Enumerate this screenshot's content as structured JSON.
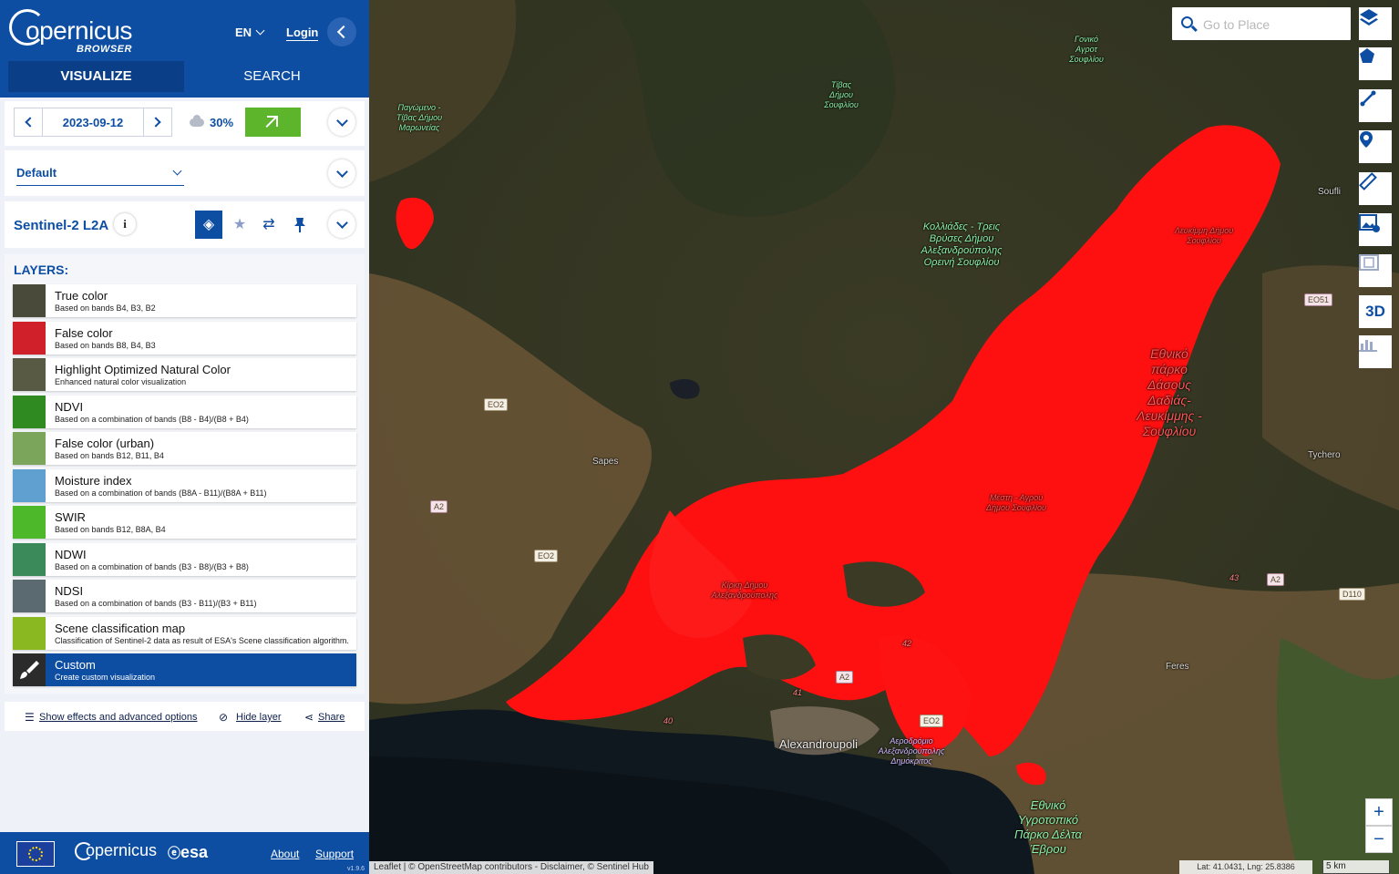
{
  "header": {
    "brand": "opernicus",
    "brand_sub": "BROWSER",
    "language": "EN",
    "login_label": "Login",
    "tabs": [
      {
        "label": "VISUALIZE",
        "active": true
      },
      {
        "label": "SEARCH",
        "active": false
      }
    ]
  },
  "date_panel": {
    "date": "2023-09-12",
    "cloud_coverage": "30%"
  },
  "theme": {
    "selected": "Default"
  },
  "dataset": {
    "title": "Sentinel-2 L2A",
    "info_label": "i"
  },
  "layers": {
    "heading": "LAYERS:",
    "items": [
      {
        "name": "True color",
        "description": "Based on bands B4, B3, B2",
        "thumb_color": "#4a4a3a"
      },
      {
        "name": "False color",
        "description": "Based on bands B8, B4, B3",
        "thumb_color": "#d0202a"
      },
      {
        "name": "Highlight Optimized Natural Color",
        "description": "Enhanced natural color visualization",
        "thumb_color": "#595a44"
      },
      {
        "name": "NDVI",
        "description": "Based on a combination of bands (B8 - B4)/(B8 + B4)",
        "thumb_color": "#2f8a22"
      },
      {
        "name": "False color (urban)",
        "description": "Based on bands B12, B11, B4",
        "thumb_color": "#7aa55a"
      },
      {
        "name": "Moisture index",
        "description": "Based on a combination of bands (B8A - B11)/(B8A + B11)",
        "thumb_color": "#5fa0d0"
      },
      {
        "name": "SWIR",
        "description": "Based on bands B12, B8A, B4",
        "thumb_color": "#4cb82a"
      },
      {
        "name": "NDWI",
        "description": "Based on a combination of bands (B3 - B8)/(B3 + B8)",
        "thumb_color": "#3a8a5a"
      },
      {
        "name": "NDSI",
        "description": "Based on a combination of bands (B3 - B11)/(B3 + B11)",
        "thumb_color": "#5a6a70"
      },
      {
        "name": "Scene classification map",
        "description": "Classification of Sentinel-2 data as result of ESA's Scene classification algorithm.",
        "thumb_color": "#8ab820"
      },
      {
        "name": "Custom",
        "description": "Create custom visualization",
        "thumb_color": "#2b2b2b",
        "active": true
      }
    ]
  },
  "options": {
    "effects_label": "Show effects and advanced options",
    "hide_label": "Hide layer",
    "share_label": "Share"
  },
  "footer": {
    "copernicus": "opernicus",
    "esa": "esa",
    "about": "About",
    "support": "Support",
    "version": "v1.9.6"
  },
  "map": {
    "search_placeholder": "Go to Place",
    "tools": [
      "layers-icon",
      "polygon-icon",
      "line-icon",
      "marker-icon",
      "ruler-icon",
      "image-download-icon",
      "film-icon",
      "3D",
      "chart-icon"
    ],
    "three_d_label": "3D",
    "zoom_in": "+",
    "zoom_out": "−",
    "attribution": "Leaflet | © OpenStreetMap contributors - Disclaimer, © Sentinel Hub",
    "coordinates": "Lat: 41.0431, Lng: 25.8386",
    "scale": "5 km",
    "places": {
      "alexandroupoli": "Alexandroupoli",
      "sapes": "Sapes",
      "soufli": "Soufli",
      "tychero": "Tychero",
      "feres": "Feres",
      "national_park": "Εθνικό πάρκο Δάσους Δαδιάς-Λευκίμμης - Σουφλίου",
      "delta_park": "Εθνικό Υγροτοπικό Πάρκο Δέλτα Έβρου",
      "pagomenou": "Παγώμενο - Τίβας Δήμου Μαρωνείας",
      "kolliadas": "Κολλιάδες - Τρεις Βρύσες Δήμου Αλεξανδρούπολης Ορεινή Σουφλίου",
      "kirki": "Κίρκη Δήμου Αλεξανδρούπολης",
      "mesti": "Μέστη - Αγρού Δήμου Σουφλίου",
      "lefkimmi": "Λευκίμμη Δήμου Σουφλίου",
      "airport": "Αεροδρόμιο Αλεξανδρούπολης Δημόκριτος",
      "dimos": "Τίβας Δήμου Σουφλίου",
      "goniko": "Γονικό Αγροτ Σουφλίου"
    },
    "roads": [
      "EO2",
      "A2",
      "EO2",
      "A2",
      "EO2",
      "EO51",
      "A2",
      "D110",
      "42",
      "41",
      "40",
      "43"
    ]
  }
}
